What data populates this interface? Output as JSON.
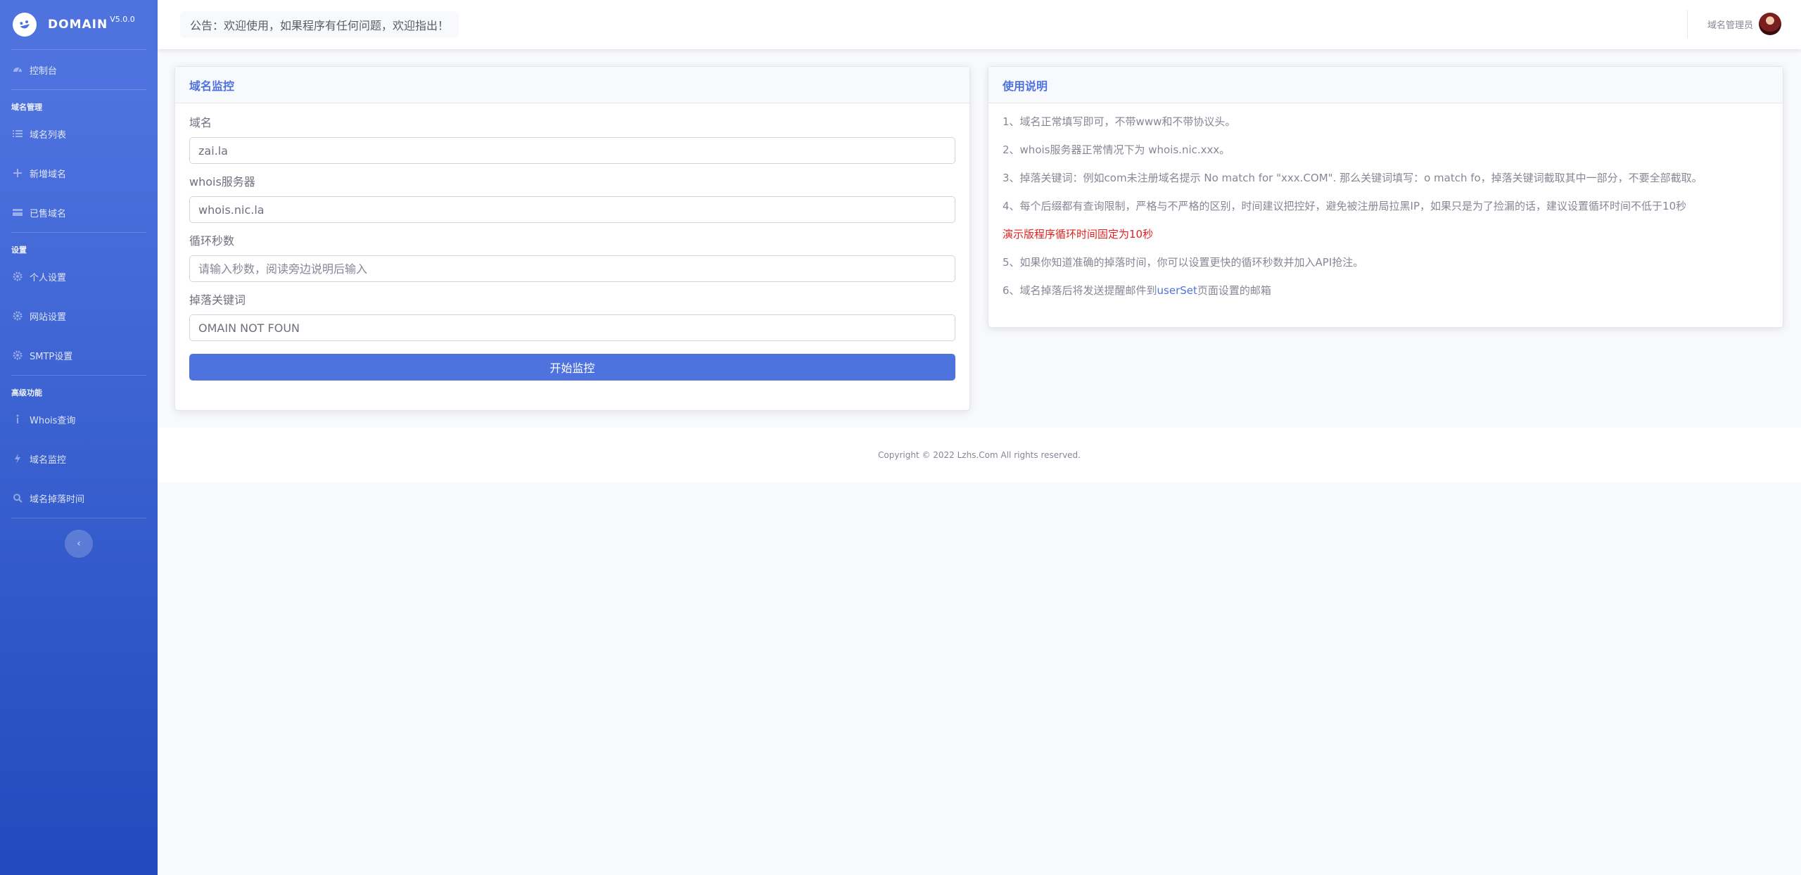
{
  "brand": {
    "name": "DOMAIN",
    "version": "V5.0.0"
  },
  "sidebar": {
    "dashboard": "控制台",
    "section1": "域名管理",
    "items1": [
      "域名列表",
      "新增域名",
      "已售域名"
    ],
    "section2": "设置",
    "items2": [
      "个人设置",
      "网站设置",
      "SMTP设置"
    ],
    "section3": "高级功能",
    "items3": [
      "Whois查询",
      "域名监控",
      "域名掉落时间"
    ],
    "toggle": "‹"
  },
  "topbar": {
    "notice": "公告：欢迎使用，如果程序有任何问题，欢迎指出！",
    "admin_name": "域名管理员"
  },
  "monitor_form": {
    "title": "域名监控",
    "domain_label": "域名",
    "domain_value": "zai.la",
    "whois_label": "whois服务器",
    "whois_value": "whois.nic.la",
    "interval_label": "循环秒数",
    "interval_placeholder": "请输入秒数，阅读旁边说明后输入",
    "keyword_label": "掉落关键词",
    "keyword_value": "OMAIN NOT FOUN",
    "submit": "开始监控"
  },
  "usage": {
    "title": "使用说明",
    "line1": "1、域名正常填写即可，不带www和不带协议头。",
    "line2": "2、whois服务器正常情况下为 whois.nic.xxx。",
    "line3": "3、掉落关键词：例如com未注册域名提示 No match for \"xxx.COM\". 那么关键词填写：o match fo，掉落关键词截取其中一部分，不要全部截取。",
    "line4": "4、每个后缀都有查询限制，严格与不严格的区别，时间建议把控好，避免被注册局拉黑IP，如果只是为了捡漏的话，建议设置循环时间不低于10秒",
    "demo_note": "演示版程序循环时间固定为10秒",
    "line5": "5、如果你知道准确的掉落时间，你可以设置更快的循环秒数并加入API抢注。",
    "line6_prefix": "6、域名掉落后将发送提醒邮件到",
    "line6_link": "userSet",
    "line6_suffix": "页面设置的邮箱"
  },
  "footer": {
    "copyright": "Copyright © 2022 Lzhs.Com All rights reserved."
  },
  "colors": {
    "primary": "#4e73df",
    "sidebar_bottom": "#224abe",
    "danger": "#e02020"
  }
}
